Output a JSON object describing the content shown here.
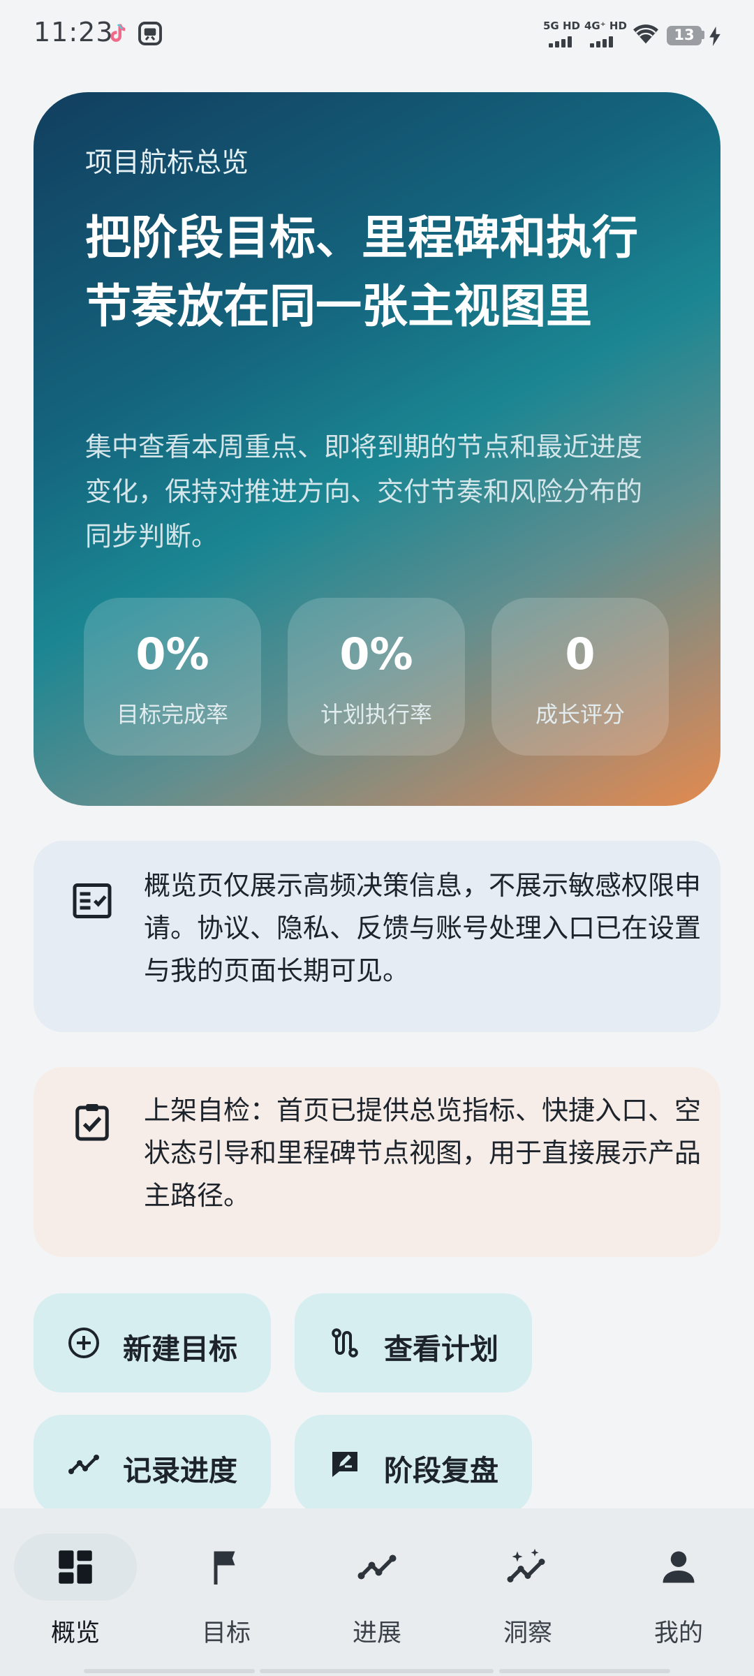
{
  "status_bar": {
    "time": "11:23",
    "notification_icons": [
      "tiktok-icon",
      "app-notification-icon"
    ],
    "signal_1_label": "5G HD",
    "signal_2_label": "4G⁺ HD",
    "battery_level": "13",
    "charging": true
  },
  "hero": {
    "eyebrow": "项目航标总览",
    "title": "把阶段目标、里程碑和执行节奏放在同一张主视图里",
    "description": "集中查看本周重点、即将到期的节点和最近进度变化，保持对推进方向、交付节奏和风险分布的同步判断。",
    "stats": [
      {
        "value": "0%",
        "label": "目标完成率"
      },
      {
        "value": "0%",
        "label": "计划执行率"
      },
      {
        "value": "0",
        "label": "成长评分"
      }
    ]
  },
  "notices": [
    {
      "icon": "checklist-icon",
      "text": "概览页仅展示高频决策信息，不展示敏感权限申请。协议、隐私、反馈与账号处理入口已在设置与我的页面长期可见。"
    },
    {
      "icon": "clipboard-check-icon",
      "text": "上架自检：首页已提供总览指标、快捷入口、空状态引导和里程碑节点视图，用于直接展示产品主路径。"
    }
  ],
  "quick_actions": [
    {
      "label": "新建目标",
      "icon": "add-circle-icon"
    },
    {
      "label": "查看计划",
      "icon": "route-icon"
    },
    {
      "label": "记录进度",
      "icon": "trend-line-icon"
    },
    {
      "label": "阶段复盘",
      "icon": "edit-comment-icon"
    }
  ],
  "bottom_nav": [
    {
      "label": "概览",
      "icon": "dashboard-icon",
      "active": true
    },
    {
      "label": "目标",
      "icon": "flag-icon",
      "active": false
    },
    {
      "label": "进展",
      "icon": "trend-line-icon",
      "active": false
    },
    {
      "label": "洞察",
      "icon": "insights-icon",
      "active": false
    },
    {
      "label": "我的",
      "icon": "person-icon",
      "active": false
    }
  ],
  "colors": {
    "background": "#f2f4f6",
    "hero_gradient_start": "#123e5f",
    "hero_gradient_end": "#e38a4d",
    "action_button": "#d7eef1",
    "notice_blue": "#e6ecf3",
    "notice_peach": "#f6ede8"
  }
}
